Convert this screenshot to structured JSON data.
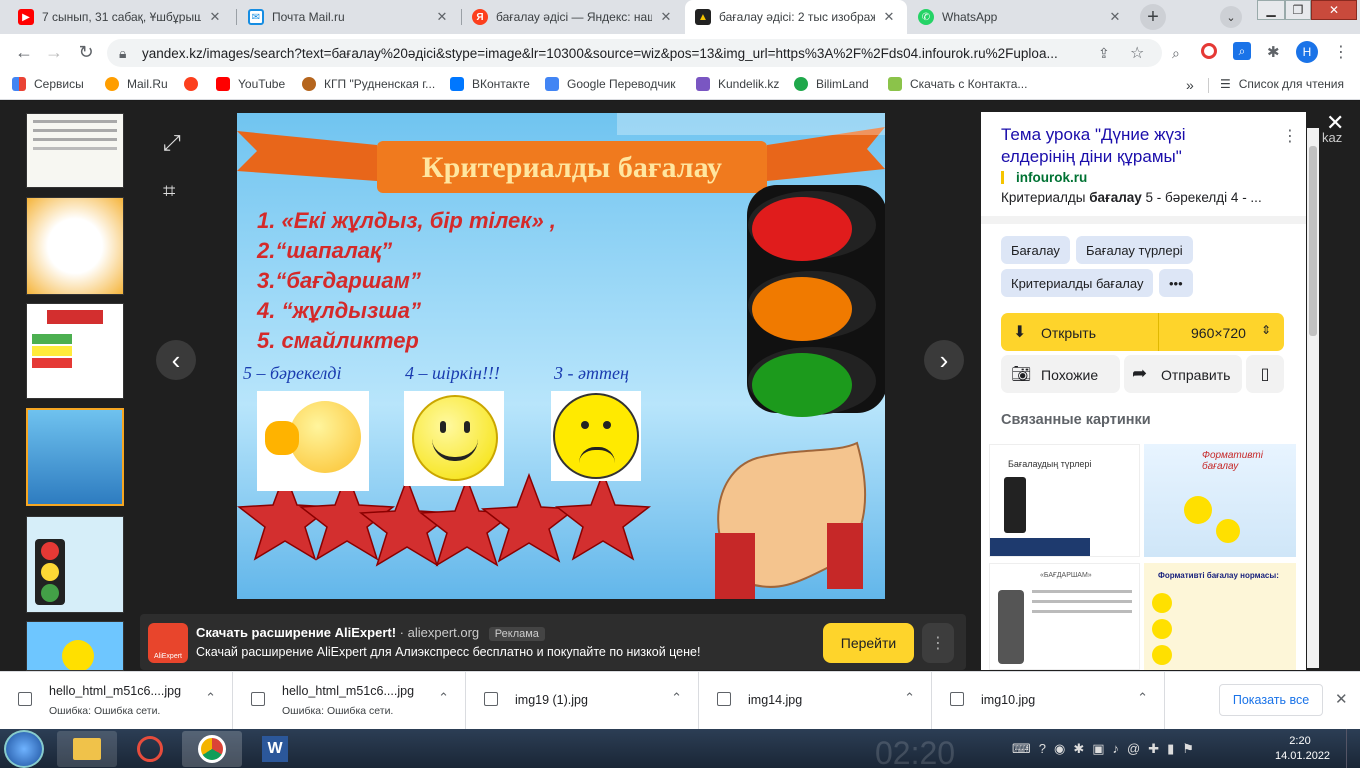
{
  "tabs": [
    {
      "title": "7 сынып, 31 сабақ, Ұшбұрыш",
      "color": "#ff0000",
      "icon": "youtube-icon"
    },
    {
      "title": "Почта Mail.ru",
      "color": "#168de2",
      "icon": "mail-icon"
    },
    {
      "title": "бағалау әдісі — Яндекс: нашл",
      "color": "#fc3f1d",
      "icon": "yandex-icon"
    },
    {
      "title": "бағалау әдісі: 2 тыс изображ",
      "color": "#f5c400",
      "icon": "yandex-images-icon",
      "active": true
    },
    {
      "title": "WhatsApp",
      "color": "#25d366",
      "icon": "whatsapp-icon"
    }
  ],
  "address": {
    "url": "yandex.kz/images/search?text=бағалау%20әдісі&stype=image&lr=10300&source=wiz&pos=13&img_url=https%3A%2F%2Fds04.infourok.ru%2Fuploa..."
  },
  "profile_initial": "Н",
  "bookmarks": [
    {
      "label": "Сервисы",
      "color": "#4285f4"
    },
    {
      "label": "Mail.Ru",
      "color": "#ff9e00"
    },
    {
      "label": "",
      "color": "#fc3f1d"
    },
    {
      "label": "YouTube",
      "color": "#ff0000"
    },
    {
      "label": "КГП \"Рудненская г...",
      "color": "#b5651d"
    },
    {
      "label": "ВКонтакте",
      "color": "#0077ff"
    },
    {
      "label": "Google Переводчик",
      "color": "#4285f4"
    },
    {
      "label": "Kundelik.kz",
      "color": "#7a56c2"
    },
    {
      "label": "BilimLand",
      "color": "#1fa84b"
    },
    {
      "label": "Скачать с Контакта...",
      "color": "#8bc34a"
    }
  ],
  "reading_list": "Список для чтения",
  "image": {
    "banner_title": "Критериалды бағалау",
    "criteria": [
      "1. «Екі жұлдыз, бір тілек» ,",
      "2.“шапалақ”",
      "3.“бағдаршам”",
      "4. “жұлдызша”",
      "5. смайликтер"
    ],
    "ratings": [
      "5 – бәрекелді",
      "4 – шіркін!!!",
      "3 - әттең"
    ]
  },
  "side_panel": {
    "title": "Тема урока \"Дүние жүзі елдерінің діни құрамы\"",
    "source": "infourok.ru",
    "description_prefix": "Критериалды ",
    "description_bold": "бағалау",
    "description_suffix": " 5 - бәрекелді 4 - ...",
    "chips": [
      "Бағалау",
      "Бағалау түрлері",
      "Критериалды бағалау",
      "•••"
    ],
    "open_label": "Открыть",
    "size_label": "960×720",
    "similar_label": "Похожие",
    "share_label": "Отправить",
    "related_heading": "Связанные картинки",
    "related": [
      {
        "caption": "Бағалаудың түрлері"
      },
      {
        "caption": "Формативті бағалау"
      },
      {
        "caption": "«БАҒДАРШАМ»"
      },
      {
        "caption": "Формативті бағалау нормасы:"
      }
    ]
  },
  "behind_text": "kaz",
  "ad": {
    "title": "Скачать расширение AliExpert!",
    "domain": "aliexpert.org",
    "badge": "Реклама",
    "text": "Скачай расширение AliExpert для Алиэкспресс бесплатно и покупайте по низкой цене!",
    "button": "Перейти",
    "logo_text": "AliExpert"
  },
  "downloads": [
    {
      "name": "hello_html_m51c6....jpg",
      "status": "Ошибка: Ошибка сети."
    },
    {
      "name": "hello_html_m51c6....jpg",
      "status": "Ошибка: Ошибка сети."
    },
    {
      "name": "img19 (1).jpg",
      "status": ""
    },
    {
      "name": "img14.jpg",
      "status": ""
    },
    {
      "name": "img10.jpg",
      "status": ""
    }
  ],
  "show_all": "Показать все",
  "clock": {
    "time": "2:20",
    "date": "14.01.2022",
    "bg_time": "02:20"
  }
}
